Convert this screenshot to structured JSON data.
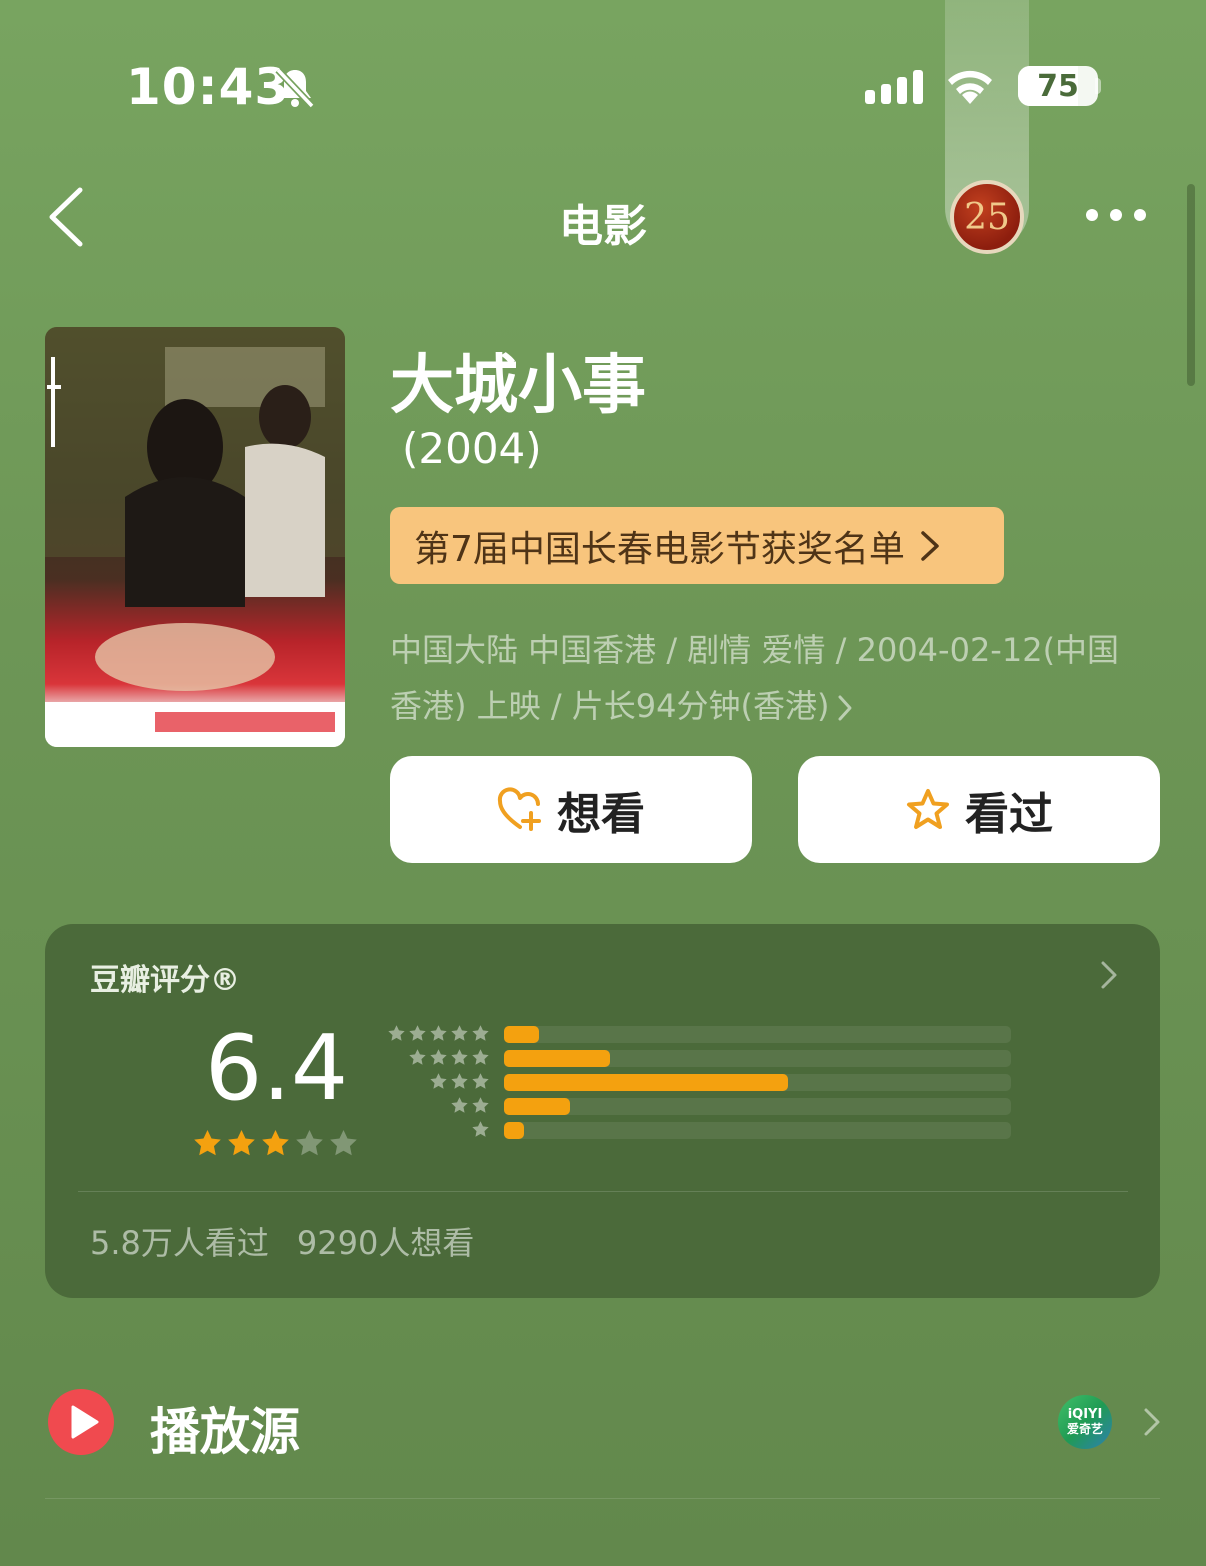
{
  "status_bar": {
    "time": "10:43",
    "battery": "75",
    "battery_level": 0.75,
    "icons": [
      "bell-muted-icon",
      "cellular-signal-icon",
      "wifi-icon",
      "battery-icon"
    ]
  },
  "nav": {
    "title": "电影",
    "back_icon": "chevron-left-icon",
    "more_icon": "more-horizontal-icon",
    "badge": "25"
  },
  "movie": {
    "title": "大城小事",
    "year": "(2004)",
    "award": "第7届中国长春电影节获奖名单",
    "meta_line1": "中国大陆 中国香港 / 剧情 爱情 / 2004-02-12(中国",
    "meta_line2": "香港) 上映 / 片长94分钟(香港)"
  },
  "actions": {
    "want_label": "想看",
    "want_icon": "heart-plus-icon",
    "seen_label": "看过",
    "seen_icon": "star-outline-icon"
  },
  "rating": {
    "title": "豆瓣评分®",
    "score": "6.4",
    "stars": 3,
    "distribution": [
      {
        "stars": 5,
        "fraction": 0.07
      },
      {
        "stars": 4,
        "fraction": 0.21
      },
      {
        "stars": 3,
        "fraction": 0.56
      },
      {
        "stars": 2,
        "fraction": 0.13
      },
      {
        "stars": 1,
        "fraction": 0.04
      }
    ],
    "watched": "5.8万人看过",
    "want": "9290人想看"
  },
  "source": {
    "label": "播放源",
    "provider_line1": "iQIYI",
    "provider_line2": "爱奇艺"
  },
  "colors": {
    "accent_orange": "#f4a10f",
    "award_bg": "#f8c57d",
    "card_bg": "#4b6a3a",
    "play_red": "#f04a4f"
  }
}
